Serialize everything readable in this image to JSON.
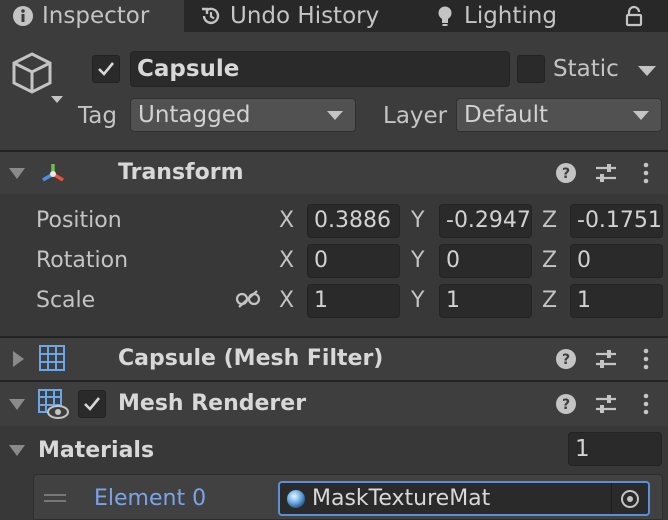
{
  "tabs": [
    {
      "label": "Inspector",
      "icon": "info-icon",
      "active": true
    },
    {
      "label": "Undo History",
      "icon": "history-icon",
      "active": false
    },
    {
      "label": "Lighting",
      "icon": "lightbulb-icon",
      "active": false
    }
  ],
  "object": {
    "name": "Capsule",
    "active": true,
    "static_label": "Static",
    "tag_label": "Tag",
    "tag_value": "Untagged",
    "layer_label": "Layer",
    "layer_value": "Default"
  },
  "transform": {
    "title": "Transform",
    "rows": [
      {
        "label": "Position",
        "x": "0.3886",
        "y": "-0.2947",
        "z": "-0.1751"
      },
      {
        "label": "Rotation",
        "x": "0",
        "y": "0",
        "z": "0"
      },
      {
        "label": "Scale",
        "x": "1",
        "y": "1",
        "z": "1"
      }
    ],
    "axes": {
      "x": "X",
      "y": "Y",
      "z": "Z"
    }
  },
  "mesh_filter": {
    "title": "Capsule (Mesh Filter)"
  },
  "mesh_renderer": {
    "title": "Mesh Renderer",
    "enabled": true,
    "materials_label": "Materials",
    "materials_count": "1",
    "element_label": "Element 0",
    "element_value": "MaskTextureMat"
  },
  "colors": {
    "accent": "#7ba4e8",
    "background": "#383838",
    "field": "#2a2a2a"
  }
}
